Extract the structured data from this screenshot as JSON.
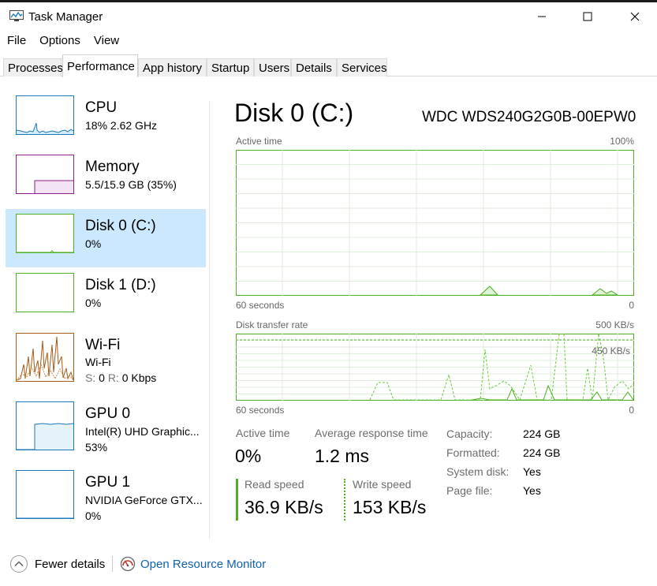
{
  "window": {
    "title": "Task Manager"
  },
  "menu": [
    "File",
    "Options",
    "View"
  ],
  "tabs": [
    "Processes",
    "Performance",
    "App history",
    "Startup",
    "Users",
    "Details",
    "Services"
  ],
  "active_tab": "Performance",
  "sidebar": [
    {
      "name": "CPU",
      "line1": "18% 2.62 GHz",
      "line2": ""
    },
    {
      "name": "Memory",
      "line1": "5.5/15.9 GB (35%)",
      "line2": ""
    },
    {
      "name": "Disk 0 (C:)",
      "line1": "0%",
      "line2": ""
    },
    {
      "name": "Disk 1 (D:)",
      "line1": "0%",
      "line2": ""
    },
    {
      "name": "Wi-Fi",
      "line1": "Wi-Fi",
      "line2_s": "S:",
      "line2_s_val": "0",
      "line2_r": "R:",
      "line2_r_val": "0 Kbps"
    },
    {
      "name": "GPU 0",
      "line1": "Intel(R) UHD Graphic...",
      "line2": "53%"
    },
    {
      "name": "GPU 1",
      "line1": "NVIDIA GeForce GTX...",
      "line2": "0%"
    }
  ],
  "selected_item": "Disk 0 (C:)",
  "panel": {
    "title": "Disk 0 (C:)",
    "model": "WDC WDS240G2G0B-00EPW0",
    "active_graph": {
      "label": "Active time",
      "max": "100%",
      "time": "60 seconds",
      "min": "0"
    },
    "transfer_graph": {
      "label": "Disk transfer rate",
      "max": "500 KB/s",
      "marker": "450 KB/s",
      "time": "60 seconds",
      "min": "0"
    },
    "stats": {
      "active_time_label": "Active time",
      "active_time_value": "0%",
      "avg_response_label": "Average response time",
      "avg_response_value": "1.2 ms",
      "read_label": "Read speed",
      "read_value": "36.9 KB/s",
      "write_label": "Write speed",
      "write_value": "153 KB/s"
    },
    "properties": [
      {
        "key": "Capacity:",
        "value": "224 GB"
      },
      {
        "key": "Formatted:",
        "value": "224 GB"
      },
      {
        "key": "System disk:",
        "value": "Yes"
      },
      {
        "key": "Page file:",
        "value": "Yes"
      }
    ]
  },
  "footer": {
    "fewer_details": "Fewer details",
    "resource_monitor": "Open Resource Monitor"
  },
  "colors": {
    "disk_green": "#4caf20",
    "cpu_blue": "#1c7ab8",
    "memory_purple": "#8b1d8b",
    "wifi_orange": "#a75a15",
    "selected_bg": "#cce8ff",
    "link_blue": "#1060b0"
  },
  "icons": [
    "task-manager-icon",
    "minimize-icon",
    "maximize-icon",
    "close-icon",
    "chevron-up-icon",
    "resource-monitor-icon"
  ]
}
